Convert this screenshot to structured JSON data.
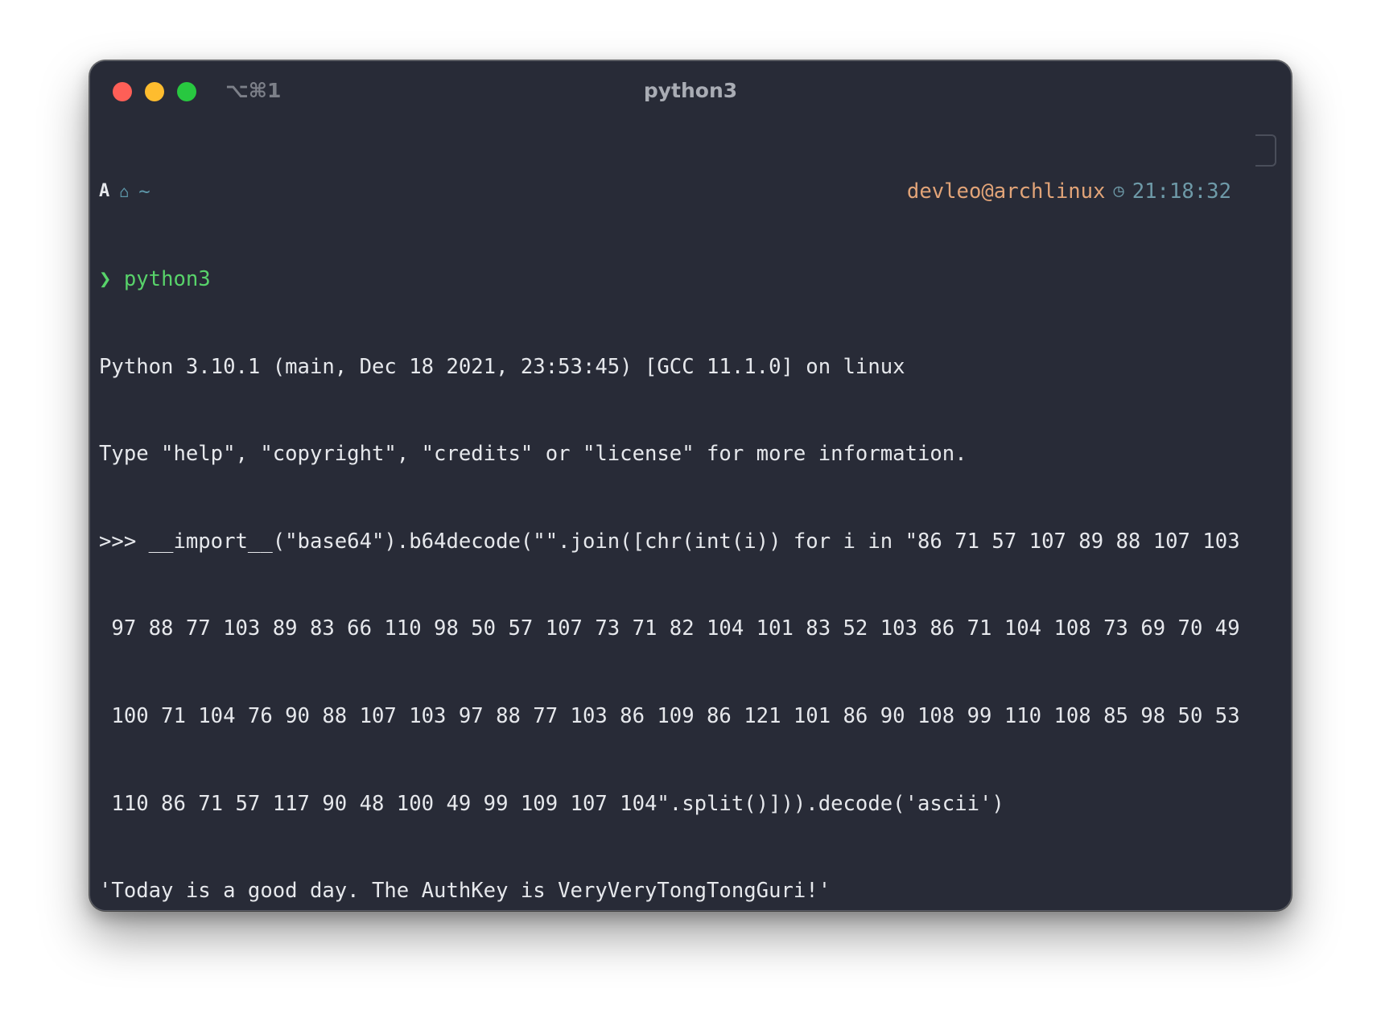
{
  "window": {
    "shortcut": "⌥⌘1",
    "title": "python3"
  },
  "prompt": {
    "arch_icon": "A",
    "home_icon": "⌂",
    "cwd": "~",
    "user_host": "devleo@archlinux",
    "clock_icon": "◷",
    "time": "21:18:32"
  },
  "command": {
    "chevron": "❯",
    "text": "python3"
  },
  "output": [
    "Python 3.10.1 (main, Dec 18 2021, 23:53:45) [GCC 11.1.0] on linux",
    "Type \"help\", \"copyright\", \"credits\" or \"license\" for more information.",
    ">>> __import__(\"base64\").b64decode(\"\".join([chr(int(i)) for i in \"86 71 57 107 89 88 107 103",
    " 97 88 77 103 89 83 66 110 98 50 57 107 73 71 82 104 101 83 52 103 86 71 104 108 73 69 70 49",
    " 100 71 104 76 90 88 107 103 97 88 77 103 86 109 86 121 101 86 90 108 99 110 108 85 98 50 53",
    " 110 86 71 57 117 90 48 100 49 99 109 107 104\".split()])).decode('ascii')",
    "'Today is a good day. The AuthKey is VeryVeryTongTongGuri!'"
  ],
  "repl_prompt": ">>> "
}
